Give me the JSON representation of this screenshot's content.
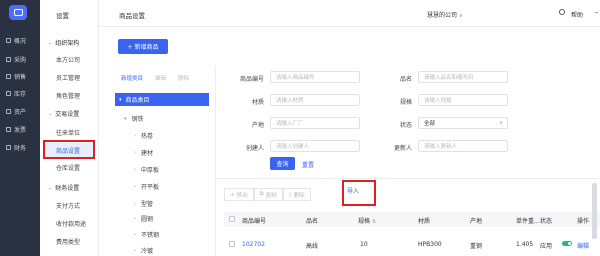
{
  "nav": {
    "items": [
      {
        "label": "概况",
        "icon": "home-icon"
      },
      {
        "label": "采购",
        "icon": "cart-icon"
      },
      {
        "label": "销售",
        "icon": "sales-icon"
      },
      {
        "label": "库存",
        "icon": "box-icon"
      },
      {
        "label": "资产",
        "icon": "asset-icon"
      },
      {
        "label": "发票",
        "icon": "invoice-icon"
      },
      {
        "label": "财务",
        "icon": "finance-icon"
      }
    ]
  },
  "subnav": {
    "title": "设置",
    "group1": "组织架构",
    "group1_items": [
      "本方公司",
      "员工管理",
      "角色管理"
    ],
    "group2": "交易设置",
    "group2_items": [
      "往来单位",
      "商品设置",
      "仓库设置"
    ],
    "group3": "财务设置",
    "group3_items": [
      "支付方式",
      "收付款用途",
      "费用类型"
    ]
  },
  "topbar": {
    "page_title": "商品设置",
    "company": "慧慧的公司",
    "company_chevron": "∨",
    "help": "帮助",
    "more": "···"
  },
  "main": {
    "add_button": "+ 新增商品",
    "tree_tabs": [
      "新增类目",
      "编辑",
      "删除"
    ],
    "tree_root": "商品类目",
    "tree_nodes": [
      "钢铁",
      "热卷",
      "建材",
      "中厚板",
      "开平板",
      "型管",
      "圆钢",
      "不锈钢",
      "冷镀"
    ]
  },
  "filters": {
    "code_label": "商品编号",
    "code_placeholder": "请输入商品编号",
    "name_label": "品名",
    "name_placeholder": "请输入品名和缩写码",
    "material_label": "材质",
    "material_placeholder": "请输入材质",
    "spec_label": "规格",
    "spec_placeholder": "请输入规格",
    "origin_label": "产地",
    "origin_placeholder": "请输入厂厂",
    "status_label": "状态",
    "status_value": "全部",
    "creator_label": "创建人",
    "creator_placeholder": "请输入创建人",
    "updater_label": "更新人",
    "updater_placeholder": "请输入更新人",
    "query_button": "查询",
    "reset_button": "重置"
  },
  "toolbar": {
    "move": "移动",
    "copy": "复制",
    "delete": "删除",
    "import": "导入"
  },
  "table": {
    "headers": [
      "商品编号",
      "品名",
      "规格",
      "材质",
      "产地",
      "单件重...",
      "状态",
      "操作"
    ],
    "rows": [
      {
        "code": "102702",
        "name": "高线",
        "spec": "10",
        "material": "HPB300",
        "origin": "重钢",
        "weight": "1.405",
        "status": "应用",
        "action": "编辑"
      }
    ]
  }
}
